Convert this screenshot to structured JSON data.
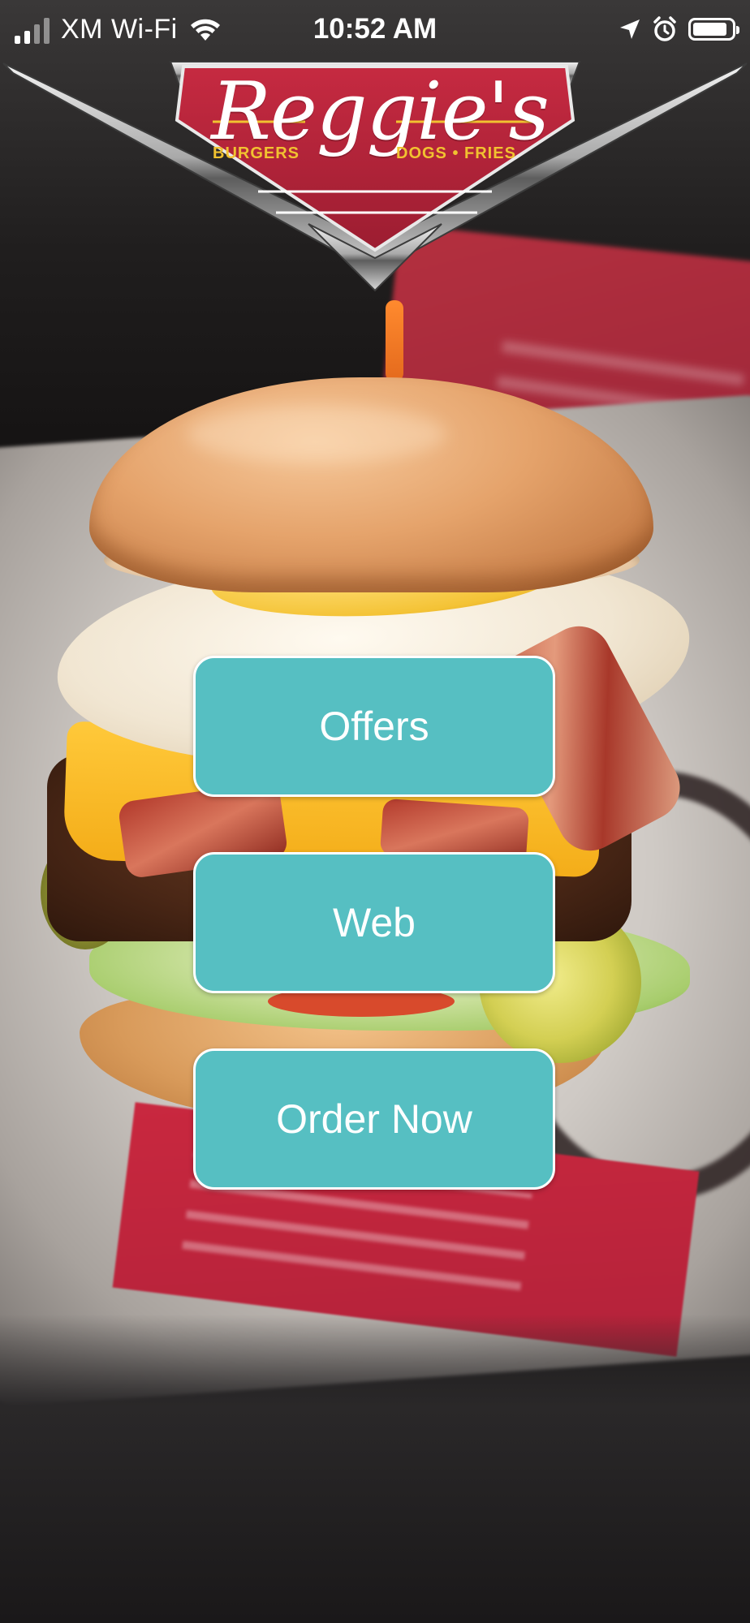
{
  "status_bar": {
    "carrier": "XM Wi-Fi",
    "time": "10:52 AM",
    "signal_bars": 4,
    "signal_bars_active": 2,
    "icons": [
      "signal-icon",
      "wifi-icon",
      "location-arrow-icon",
      "alarm-clock-icon",
      "battery-icon"
    ],
    "battery_level": 0.9
  },
  "logo": {
    "title": "Reggie's",
    "tagline_left": "BURGERS",
    "tagline_right": "DOGS • FRIES",
    "colors": {
      "badge_red": "#b5233a",
      "chrome": "#c9c9c9",
      "tagline_yellow": "#f1c230"
    }
  },
  "hero_image": {
    "subject": "burger-photo"
  },
  "actions": {
    "offers_label": "Offers",
    "web_label": "Web",
    "order_label": "Order Now",
    "button_color": "#56bfc2"
  }
}
